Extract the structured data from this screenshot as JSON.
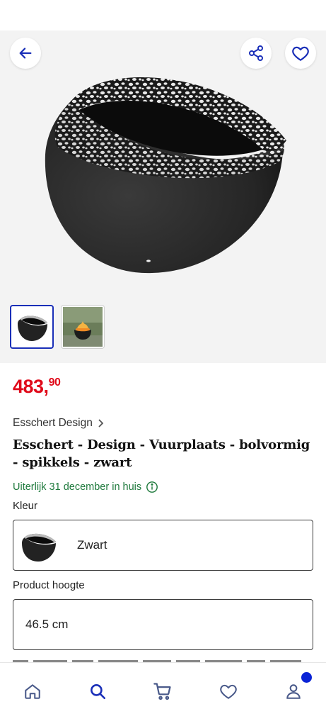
{
  "header": {
    "back_icon": "arrow-left-icon",
    "share_icon": "share-icon",
    "favorite_icon": "heart-icon"
  },
  "gallery": {
    "thumbnails": [
      {
        "name": "fire-bowl-product",
        "active": true
      },
      {
        "name": "fire-bowl-in-garden",
        "active": false
      }
    ]
  },
  "product": {
    "price_whole": "483,",
    "price_cents": "90",
    "brand": "Esschert Design",
    "title": "Esschert - Design - Vuurplaats - bolvormig - spikkels - zwart",
    "delivery": "Uiterlijk 31 december in huis",
    "color_label": "Kleur",
    "color_value": "Zwart",
    "height_label": "Product hoogte",
    "height_value": "46.5 cm"
  },
  "bottom_nav": {
    "items": [
      "home-icon",
      "search-icon",
      "cart-icon",
      "heart-icon",
      "account-icon"
    ],
    "active": "search-icon"
  },
  "colors": {
    "price": "#e00a1a",
    "accent": "#1a2fb8",
    "delivery": "#1f7a3d"
  }
}
